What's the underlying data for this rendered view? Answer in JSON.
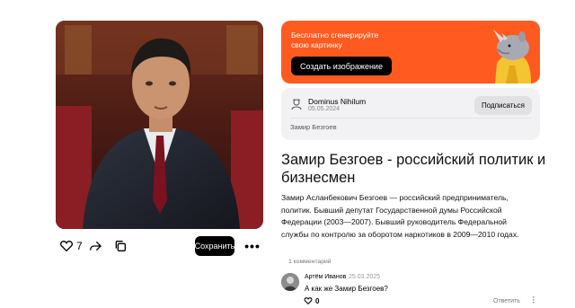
{
  "post": {
    "likes": "7",
    "save_label": "Сохранить",
    "more_label": "•••"
  },
  "promo": {
    "text_line1": "Бесплатно сгенерируйте",
    "text_line2": "свою картинку",
    "button_label": "Создать изображение"
  },
  "author": {
    "name": "Dominus Nihilum",
    "date": "05.05.2024",
    "subscribe_label": "Подписаться",
    "tag": "Замир Безгоев"
  },
  "article": {
    "title_line1": "Замир Безгоев - российский политик и",
    "title_line2": "бизнесмен",
    "body_line1": "Замир Асланбекович Безгоев — российский предприниматель,",
    "body_line2": "политик. Бывший депутат Государственной думы Российской",
    "body_line3": "Федерации (2003—2007). Бывший руководитель Федеральной",
    "body_line4": "службы по контролю за оборотом наркотиков в 2009—2010 годах."
  },
  "comments": {
    "count_label": "1 комментарий",
    "items": [
      {
        "author": "Артём Иванов",
        "date": "25.03.2025",
        "text": "А как же Замир Безгоев?",
        "likes": "0",
        "reply_label": "Ответить"
      }
    ]
  },
  "colors": {
    "promo_bg": "#ff5a1f",
    "card_bg": "#f2f2f4",
    "button_dark": "#000000"
  }
}
